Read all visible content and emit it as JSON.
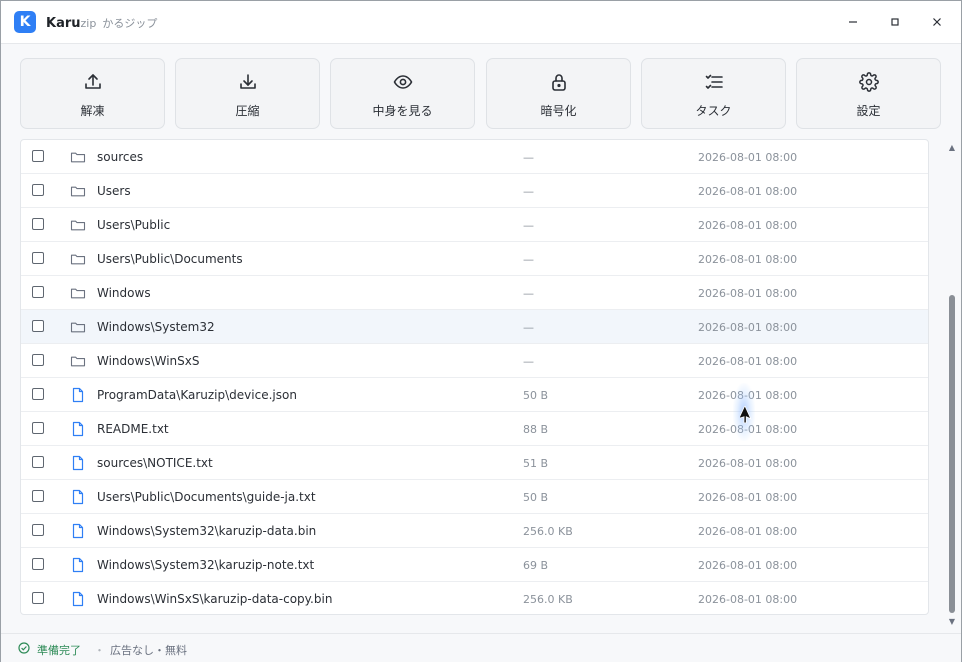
{
  "window": {
    "app_name_bold": "Karu",
    "app_name_tail": "zip",
    "app_subtitle": "かるジップ",
    "logo_letter": "K",
    "accent_color": "#2f7ff5"
  },
  "toolbar": {
    "buttons": [
      {
        "icon": "upload-icon",
        "label": "解凍"
      },
      {
        "icon": "download-icon",
        "label": "圧縮"
      },
      {
        "icon": "eye-icon",
        "label": "中身を見る"
      },
      {
        "icon": "lock-icon",
        "label": "暗号化"
      },
      {
        "icon": "tasks-icon",
        "label": "タスク"
      },
      {
        "icon": "gear-icon",
        "label": "設定"
      }
    ]
  },
  "files": {
    "rows": [
      {
        "type": "folder",
        "name": "sources",
        "size": "—",
        "date": "2026-08-01 08:00"
      },
      {
        "type": "folder",
        "name": "Users",
        "size": "—",
        "date": "2026-08-01 08:00"
      },
      {
        "type": "folder",
        "name": "Users\\Public",
        "size": "—",
        "date": "2026-08-01 08:00"
      },
      {
        "type": "folder",
        "name": "Users\\Public\\Documents",
        "size": "—",
        "date": "2026-08-01 08:00"
      },
      {
        "type": "folder",
        "name": "Windows",
        "size": "—",
        "date": "2026-08-01 08:00"
      },
      {
        "type": "folder",
        "name": "Windows\\System32",
        "size": "—",
        "date": "2026-08-01 08:00"
      },
      {
        "type": "folder",
        "name": "Windows\\WinSxS",
        "size": "—",
        "date": "2026-08-01 08:00"
      },
      {
        "type": "file",
        "name": "ProgramData\\Karuzip\\device.json",
        "size": "50 B",
        "date": "2026-08-01 08:00"
      },
      {
        "type": "file",
        "name": "README.txt",
        "size": "88 B",
        "date": "2026-08-01 08:00"
      },
      {
        "type": "file",
        "name": "sources\\NOTICE.txt",
        "size": "51 B",
        "date": "2026-08-01 08:00"
      },
      {
        "type": "file",
        "name": "Users\\Public\\Documents\\guide-ja.txt",
        "size": "50 B",
        "date": "2026-08-01 08:00"
      },
      {
        "type": "file",
        "name": "Windows\\System32\\karuzip-data.bin",
        "size": "256.0 KB",
        "date": "2026-08-01 08:00"
      },
      {
        "type": "file",
        "name": "Windows\\System32\\karuzip-note.txt",
        "size": "69 B",
        "date": "2026-08-01 08:00"
      },
      {
        "type": "file",
        "name": "Windows\\WinSxS\\karuzip-data-copy.bin",
        "size": "256.0 KB",
        "date": "2026-08-01 08:00"
      }
    ]
  },
  "status": {
    "ready": "準備完了",
    "separator": "・",
    "note": "広告なし・無料",
    "ready_color": "#2e8b57"
  }
}
